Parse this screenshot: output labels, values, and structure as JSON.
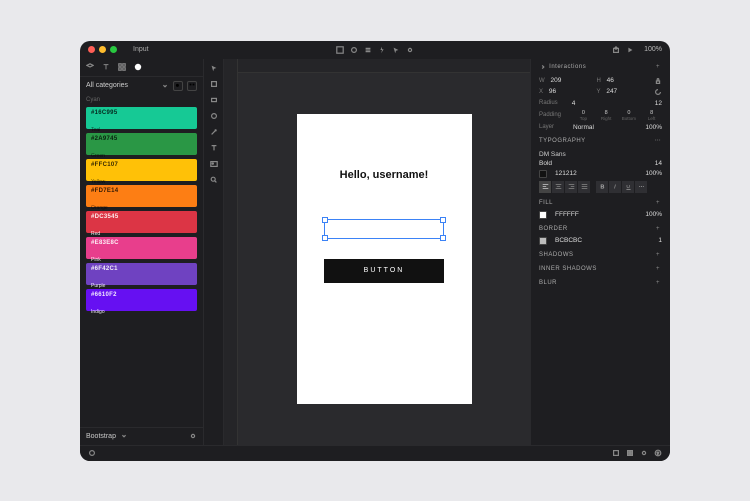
{
  "title": "Input",
  "zoom": "100%",
  "categories_label": "All categories",
  "first_sub": "Cyan",
  "swatches": [
    {
      "code": "#16C995",
      "name": "Teal",
      "bg": "#16c995",
      "light": false
    },
    {
      "code": "#2A9745",
      "name": "Green",
      "bg": "#2a9745",
      "light": false
    },
    {
      "code": "#FFC107",
      "name": "Yellow",
      "bg": "#ffc107",
      "light": false
    },
    {
      "code": "#FD7E14",
      "name": "Orange",
      "bg": "#fd7e14",
      "light": false
    },
    {
      "code": "#DC3545",
      "name": "Red",
      "bg": "#dc3545",
      "light": true
    },
    {
      "code": "#E83E8C",
      "name": "Pink",
      "bg": "#e83e8c",
      "light": true
    },
    {
      "code": "#6F42C1",
      "name": "Purple",
      "bg": "#6f42c1",
      "light": true
    },
    {
      "code": "#6610F2",
      "name": "Indigo",
      "bg": "#6610f2",
      "light": true
    }
  ],
  "bottom_label": "Bootstrap",
  "canvas": {
    "heading": "Hello, username!",
    "button": "BUTTON"
  },
  "inspector": {
    "interactions_label": "Interactions",
    "w_label": "W",
    "w": "209",
    "h_label": "H",
    "h": "46",
    "x_label": "X",
    "x": "96",
    "y_label": "Y",
    "y": "247",
    "radius_label": "Radius",
    "radius": "4",
    "r_val": "12",
    "padding_label": "Padding",
    "pad": [
      "0",
      "8",
      "0",
      "8"
    ],
    "pad_sides": [
      "Top",
      "Right",
      "Bottom",
      "Left"
    ],
    "layer_label": "Layer",
    "blend": "Normal",
    "opacity": "100%",
    "typo_label": "TYPOGRAPHY",
    "font": "DM Sans",
    "weight": "Bold",
    "size": "14",
    "text_color": "121212",
    "text_opacity": "100%",
    "fill_label": "FILL",
    "fill_color": "FFFFFF",
    "fill_opacity": "100%",
    "border_label": "BORDER",
    "border_color": "BCBCBC",
    "border_width": "1",
    "shadows_label": "SHADOWS",
    "inner_shadows_label": "INNER SHADOWS",
    "blur_label": "BLUR"
  }
}
